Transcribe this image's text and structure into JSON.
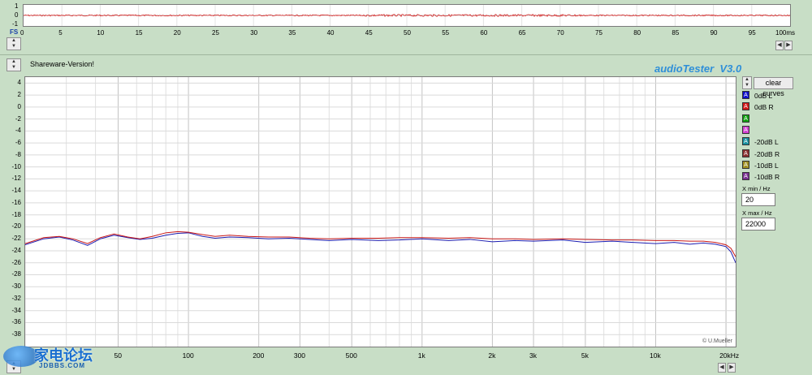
{
  "header": {
    "notice": "Shareware-Version!",
    "brand": "audioTester  V3.0"
  },
  "top_scope": {
    "fs_label": "FS",
    "y_ticks": [
      "1",
      "0",
      "-1"
    ],
    "x_ticks": [
      "0",
      "5",
      "10",
      "15",
      "20",
      "25",
      "30",
      "35",
      "40",
      "45",
      "50",
      "55",
      "60",
      "65",
      "70",
      "75",
      "80",
      "85",
      "90",
      "95",
      "100ms"
    ]
  },
  "main_plot": {
    "credit": "© U.Mueller"
  },
  "side_panel": {
    "clear_label": "clear curves",
    "legend": [
      {
        "letter": "A",
        "label": "0dB L",
        "color": "#1010cc"
      },
      {
        "letter": "A",
        "label": "0dB R",
        "color": "#d01818"
      },
      {
        "letter": "A",
        "label": "",
        "color": "#10a010"
      },
      {
        "letter": "A",
        "label": "",
        "color": "#d040d0"
      },
      {
        "letter": "A",
        "label": "-20dB L",
        "color": "#1890a0"
      },
      {
        "letter": "A",
        "label": "-20dB R",
        "color": "#8a3030"
      },
      {
        "letter": "A",
        "label": "-10dB L",
        "color": "#a09020"
      },
      {
        "letter": "A",
        "label": "-10dB R",
        "color": "#7a3090"
      }
    ],
    "xmin_label": "X min / Hz",
    "xmin_value": "20",
    "xmax_label": "X max / Hz",
    "xmax_value": "22000"
  },
  "watermark": {
    "text": "家电论坛",
    "sub": "JDBBS.COM"
  },
  "chart_data": {
    "type": "line",
    "xscale": "log",
    "xlim": [
      20,
      22000
    ],
    "ylim": [
      -40,
      5
    ],
    "yticks": [
      4,
      2,
      0,
      -2,
      -4,
      -6,
      -8,
      -10,
      -12,
      -14,
      -16,
      -18,
      -20,
      -22,
      -24,
      -26,
      -28,
      -30,
      -32,
      -34,
      -36,
      -38
    ],
    "y_tick_labels": [
      "4",
      "2",
      "0",
      "-2",
      "-4",
      "-6",
      "-8",
      "-10",
      "-12",
      "-14",
      "-16",
      "-18",
      "-20",
      "-22",
      "-24",
      "-26",
      "-28",
      "-30",
      "-32",
      "-34",
      "-36",
      "-38"
    ],
    "xticks": [
      50,
      100,
      200,
      300,
      500,
      1000,
      2000,
      3000,
      5000,
      10000,
      20000
    ],
    "x_tick_labels": [
      "50",
      "100",
      "200",
      "300",
      "500",
      "1k",
      "2k",
      "3k",
      "5k",
      "10k",
      "20kHz"
    ],
    "grid": true,
    "series": [
      {
        "name": "0dB L",
        "color": "#1c1cb0",
        "x": [
          20,
          24,
          28,
          32,
          37,
          42,
          48,
          55,
          62,
          70,
          80,
          90,
          100,
          115,
          130,
          150,
          180,
          220,
          270,
          330,
          400,
          500,
          650,
          800,
          1000,
          1300,
          1600,
          2000,
          2500,
          3000,
          4000,
          5000,
          6500,
          8000,
          10000,
          12000,
          14000,
          16000,
          18000,
          20000,
          21000,
          22000
        ],
        "y": [
          -23.0,
          -22.0,
          -21.7,
          -22.2,
          -23.1,
          -22.0,
          -21.4,
          -21.8,
          -22.1,
          -21.9,
          -21.4,
          -21.1,
          -21.0,
          -21.6,
          -21.9,
          -21.7,
          -21.8,
          -22.0,
          -21.9,
          -22.1,
          -22.3,
          -22.1,
          -22.3,
          -22.2,
          -22.0,
          -22.3,
          -22.1,
          -22.5,
          -22.3,
          -22.4,
          -22.2,
          -22.6,
          -22.4,
          -22.6,
          -22.8,
          -22.6,
          -22.9,
          -22.7,
          -22.9,
          -23.3,
          -24.2,
          -26.0
        ]
      },
      {
        "name": "0dB R",
        "color": "#c81818",
        "x": [
          20,
          24,
          28,
          32,
          37,
          42,
          48,
          55,
          62,
          70,
          80,
          90,
          100,
          115,
          130,
          150,
          180,
          220,
          270,
          330,
          400,
          500,
          650,
          800,
          1000,
          1300,
          1600,
          2000,
          2500,
          3000,
          4000,
          5000,
          6500,
          8000,
          10000,
          12000,
          14000,
          16000,
          18000,
          20000,
          21000,
          22000
        ],
        "y": [
          -22.8,
          -21.8,
          -21.6,
          -22.0,
          -22.8,
          -21.8,
          -21.2,
          -21.7,
          -22.0,
          -21.6,
          -21.0,
          -20.8,
          -20.9,
          -21.3,
          -21.6,
          -21.4,
          -21.6,
          -21.7,
          -21.7,
          -21.9,
          -22.0,
          -21.9,
          -21.9,
          -21.8,
          -21.8,
          -21.9,
          -21.8,
          -22.0,
          -22.0,
          -22.1,
          -22.0,
          -22.1,
          -22.2,
          -22.2,
          -22.3,
          -22.3,
          -22.4,
          -22.4,
          -22.6,
          -23.0,
          -23.6,
          -25.0
        ]
      }
    ]
  }
}
